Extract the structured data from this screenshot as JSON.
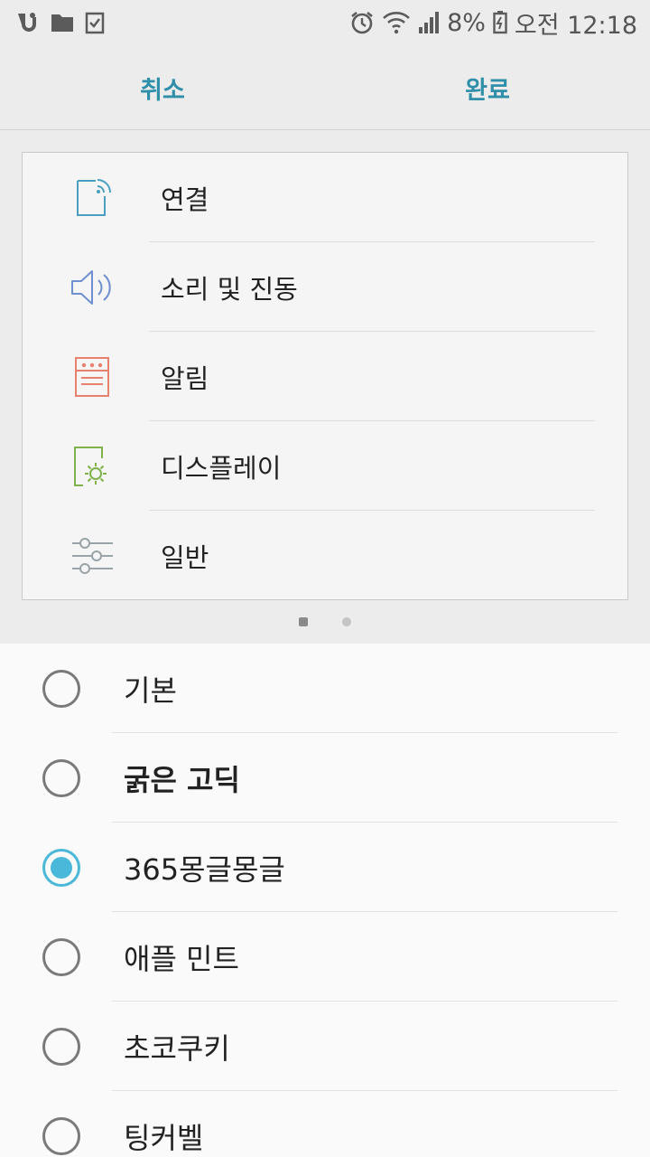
{
  "status_bar": {
    "left_icons": [
      "u-plus-icon",
      "folder-icon",
      "clipboard-check-icon"
    ],
    "battery_text": "8%",
    "time_text": "오전 12:18"
  },
  "action_bar": {
    "cancel_label": "취소",
    "done_label": "완료",
    "accent_color": "#2f8ea8"
  },
  "preview": {
    "items": [
      {
        "label": "연결",
        "icon": "connection-icon",
        "color": "#4a9fc0"
      },
      {
        "label": "소리 및 진동",
        "icon": "speaker-icon",
        "color": "#6f8fd0"
      },
      {
        "label": "알림",
        "icon": "notification-icon",
        "color": "#e8806e"
      },
      {
        "label": "디스플레이",
        "icon": "display-icon",
        "color": "#7fb24a"
      },
      {
        "label": "일반",
        "icon": "sliders-icon",
        "color": "#9aa3a8"
      }
    ],
    "page_indicator": {
      "pages": 2,
      "current": 1
    }
  },
  "font_options": {
    "selected_index": 2,
    "radio_color": "#4ab8d8",
    "items": [
      {
        "label": "기본"
      },
      {
        "label": "굵은 고딕"
      },
      {
        "label": "365몽글몽글"
      },
      {
        "label": "애플 민트"
      },
      {
        "label": "초코쿠키"
      },
      {
        "label": "팅커벨"
      }
    ]
  }
}
